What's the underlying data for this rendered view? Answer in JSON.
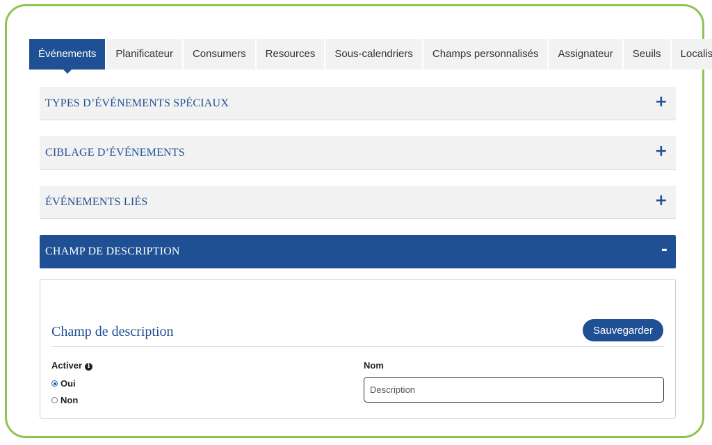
{
  "tabs": [
    {
      "label": "Événements",
      "active": true
    },
    {
      "label": "Planificateur",
      "active": false
    },
    {
      "label": "Consumers",
      "active": false
    },
    {
      "label": "Resources",
      "active": false
    },
    {
      "label": "Sous-calendriers",
      "active": false
    },
    {
      "label": "Champs personnalisés",
      "active": false
    },
    {
      "label": "Assignateur",
      "active": false
    },
    {
      "label": "Seuils",
      "active": false
    },
    {
      "label": "Localisateur",
      "active": false
    }
  ],
  "accordion": [
    {
      "title": "TYPES D’ÉVÉNEMENTS SPÉCIAUX",
      "toggle": "+",
      "expanded": false
    },
    {
      "title": "CIBLAGE D’ÉVÉNEMENTS",
      "toggle": "+",
      "expanded": false
    },
    {
      "title": "ÉVÉNEMENTS LIÉS",
      "toggle": "+",
      "expanded": false
    },
    {
      "title": "CHAMP DE DESCRIPTION",
      "toggle": "-",
      "expanded": true
    }
  ],
  "panel": {
    "title": "Champ de description",
    "save_label": "Sauvegarder",
    "activer_label": "Activer",
    "info_icon": "info-icon",
    "options": [
      {
        "label": "Oui",
        "checked": true
      },
      {
        "label": "Non",
        "checked": false
      }
    ],
    "nom_label": "Nom",
    "nom_value": "",
    "nom_placeholder": "Description"
  },
  "colors": {
    "primary": "#1f5094",
    "frame_border": "#8ec352",
    "tab_bg": "#f2f2f2",
    "radio_selected": "#1f5fbf"
  }
}
